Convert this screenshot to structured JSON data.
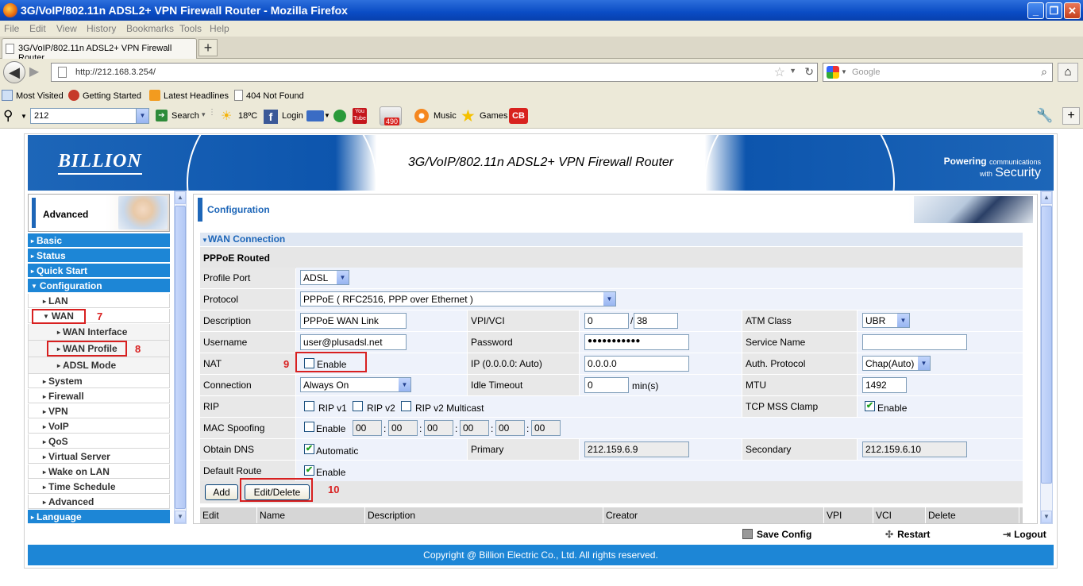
{
  "window": {
    "title": "3G/VoIP/802.11n ADSL2+ VPN Firewall Router - Mozilla Firefox",
    "minimize": "_",
    "maximize": "❐",
    "close": "✕"
  },
  "menu": [
    "File",
    "Edit",
    "View",
    "History",
    "Bookmarks",
    "Tools",
    "Help"
  ],
  "tab": {
    "label": "3G/VoIP/802.11n ADSL2+ VPN Firewall Router",
    "new_tab": "+"
  },
  "nav": {
    "url": "http://212.168.3.254/",
    "search_placeholder": "Google"
  },
  "bookmarks": [
    "Most Visited",
    "Getting Started",
    "Latest Headlines",
    "404 Not Found"
  ],
  "toolbar": {
    "query": "212",
    "search": "Search",
    "weather": "18ºC",
    "login": "Login",
    "badge": "490",
    "music": "Music",
    "games": "Games",
    "cb": "CB"
  },
  "banner": {
    "logo": "BILLION",
    "title": "3G/VoIP/802.11n ADSL2+ VPN Firewall Router",
    "tag_line1": "Powering",
    "tag_small": "communications",
    "tag_with": "with",
    "tag_line2": "Security"
  },
  "sidebar": {
    "mode": "Advanced",
    "items": [
      {
        "label": "Basic",
        "level": "main"
      },
      {
        "label": "Status",
        "level": "main"
      },
      {
        "label": "Quick Start",
        "level": "main"
      },
      {
        "label": "Configuration",
        "level": "main"
      },
      {
        "label": "LAN",
        "level": "sub"
      },
      {
        "label": "WAN",
        "level": "sub"
      },
      {
        "label": "WAN Interface",
        "level": "sub2"
      },
      {
        "label": "WAN Profile",
        "level": "sub2"
      },
      {
        "label": "ADSL Mode",
        "level": "sub2"
      },
      {
        "label": "System",
        "level": "sub"
      },
      {
        "label": "Firewall",
        "level": "sub"
      },
      {
        "label": "VPN",
        "level": "sub"
      },
      {
        "label": "VoIP",
        "level": "sub"
      },
      {
        "label": "QoS",
        "level": "sub"
      },
      {
        "label": "Virtual Server",
        "level": "sub"
      },
      {
        "label": "Wake on LAN",
        "level": "sub"
      },
      {
        "label": "Time Schedule",
        "level": "sub"
      },
      {
        "label": "Advanced",
        "level": "sub"
      },
      {
        "label": "Language",
        "level": "main"
      }
    ]
  },
  "annotations": {
    "wan": "7",
    "profile": "8",
    "nat": "9",
    "edit": "10"
  },
  "content": {
    "header": "Configuration",
    "section_title": "WAN Connection",
    "subsection": "PPPoE Routed",
    "profile_port": {
      "label": "Profile Port",
      "value": "ADSL"
    },
    "protocol": {
      "label": "Protocol",
      "value": "PPPoE ( RFC2516, PPP over Ethernet )"
    },
    "description": {
      "label": "Description",
      "value": "PPPoE WAN Link"
    },
    "vpivci": {
      "label": "VPI/VCI",
      "vpi": "0",
      "sep": "/",
      "vci": "38"
    },
    "atm_class": {
      "label": "ATM Class",
      "value": "UBR"
    },
    "username": {
      "label": "Username",
      "value": "user@plusadsl.net"
    },
    "password": {
      "label": "Password",
      "value": "●●●●●●●●●●●"
    },
    "service_name": {
      "label": "Service Name",
      "value": ""
    },
    "nat": {
      "label": "NAT",
      "option": "Enable"
    },
    "ip": {
      "label": "IP (0.0.0.0: Auto)",
      "value": "0.0.0.0"
    },
    "auth": {
      "label": "Auth. Protocol",
      "value": "Chap(Auto)"
    },
    "connection": {
      "label": "Connection",
      "value": "Always On"
    },
    "idle": {
      "label": "Idle Timeout",
      "value": "0",
      "unit": "min(s)"
    },
    "mtu": {
      "label": "MTU",
      "value": "1492"
    },
    "rip": {
      "label": "RIP",
      "v1": "RIP v1",
      "v2": "RIP v2",
      "v2m": "RIP v2 Multicast"
    },
    "tcp_mss": {
      "label": "TCP MSS Clamp",
      "option": "Enable"
    },
    "mac": {
      "label": "MAC Spoofing",
      "option": "Enable",
      "octets": [
        "00",
        "00",
        "00",
        "00",
        "00",
        "00"
      ],
      "sep": ":"
    },
    "dns": {
      "label": "Obtain DNS",
      "option": "Automatic",
      "primary_label": "Primary",
      "primary": "212.159.6.9",
      "secondary_label": "Secondary",
      "secondary": "212.159.6.10"
    },
    "default_route": {
      "label": "Default Route",
      "option": "Enable"
    },
    "add_button": "Add",
    "edit_button": "Edit/Delete",
    "table_headers": [
      "Edit",
      "Name",
      "Description",
      "Creator",
      "VPI",
      "VCI",
      "Delete"
    ]
  },
  "footer": {
    "save": "Save Config",
    "restart": "Restart",
    "logout": "Logout",
    "copyright": "Copyright @ Billion Electric Co., Ltd. All rights reserved."
  },
  "colors": {
    "accent": "#1d66b8",
    "menu_blue": "#1d86d6",
    "annotation_red": "#d82020"
  }
}
